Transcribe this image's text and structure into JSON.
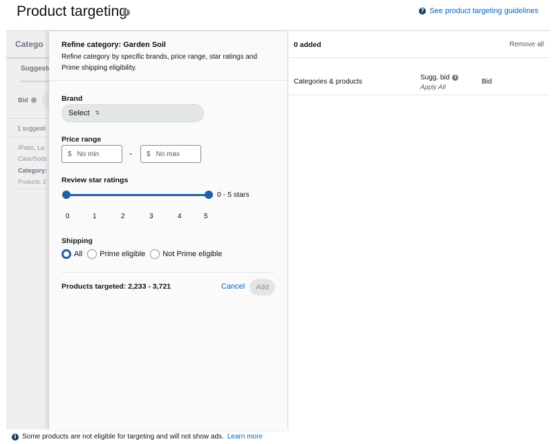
{
  "header": {
    "title": "Product targeting",
    "guidelines_link": "See product targeting guidelines"
  },
  "left_pane": {
    "tab": "Catego",
    "subtab": "Suggeste",
    "bid_label": "Bid",
    "suggestions": "1 suggesti",
    "path_line1": "/Patio, La",
    "path_line2": "Care/Soils",
    "category": "Category:",
    "products": "Products: 2"
  },
  "refine": {
    "title": "Refine category: Garden Soil",
    "description": "Refine category by specific brands, price range, star ratings and Prime shipping eligibility.",
    "brand_label": "Brand",
    "brand_select": "Select",
    "price_label": "Price range",
    "currency": "$",
    "min_placeholder": "No min",
    "max_placeholder": "No max",
    "price_separator": "-",
    "rating_label": "Review star ratings",
    "rating_value": "0 - 5 stars",
    "rating_range": [
      0,
      5
    ],
    "ticks": [
      "0",
      "1",
      "2",
      "3",
      "4",
      "5"
    ],
    "shipping_label": "Shipping",
    "shipping_options": [
      {
        "label": "All",
        "checked": true
      },
      {
        "label": "Prime eligible",
        "checked": false
      },
      {
        "label": "Not Prime eligible",
        "checked": false
      }
    ],
    "products_targeted": "Products targeted: 2,233 - 3,721",
    "cancel": "Cancel",
    "add": "Add"
  },
  "right_pane": {
    "added": "0 added",
    "remove_all": "Remove all",
    "col_categories": "Categories & products",
    "col_sugg_bid": "Sugg. bid",
    "apply_all": "Apply All",
    "col_bid": "Bid"
  },
  "footer": {
    "notice": "Some products are not eligible for targeting and will not show ads.",
    "learn_more": "Learn more"
  },
  "colors": {
    "accent": "#1f5faa",
    "link": "#0066c0"
  }
}
